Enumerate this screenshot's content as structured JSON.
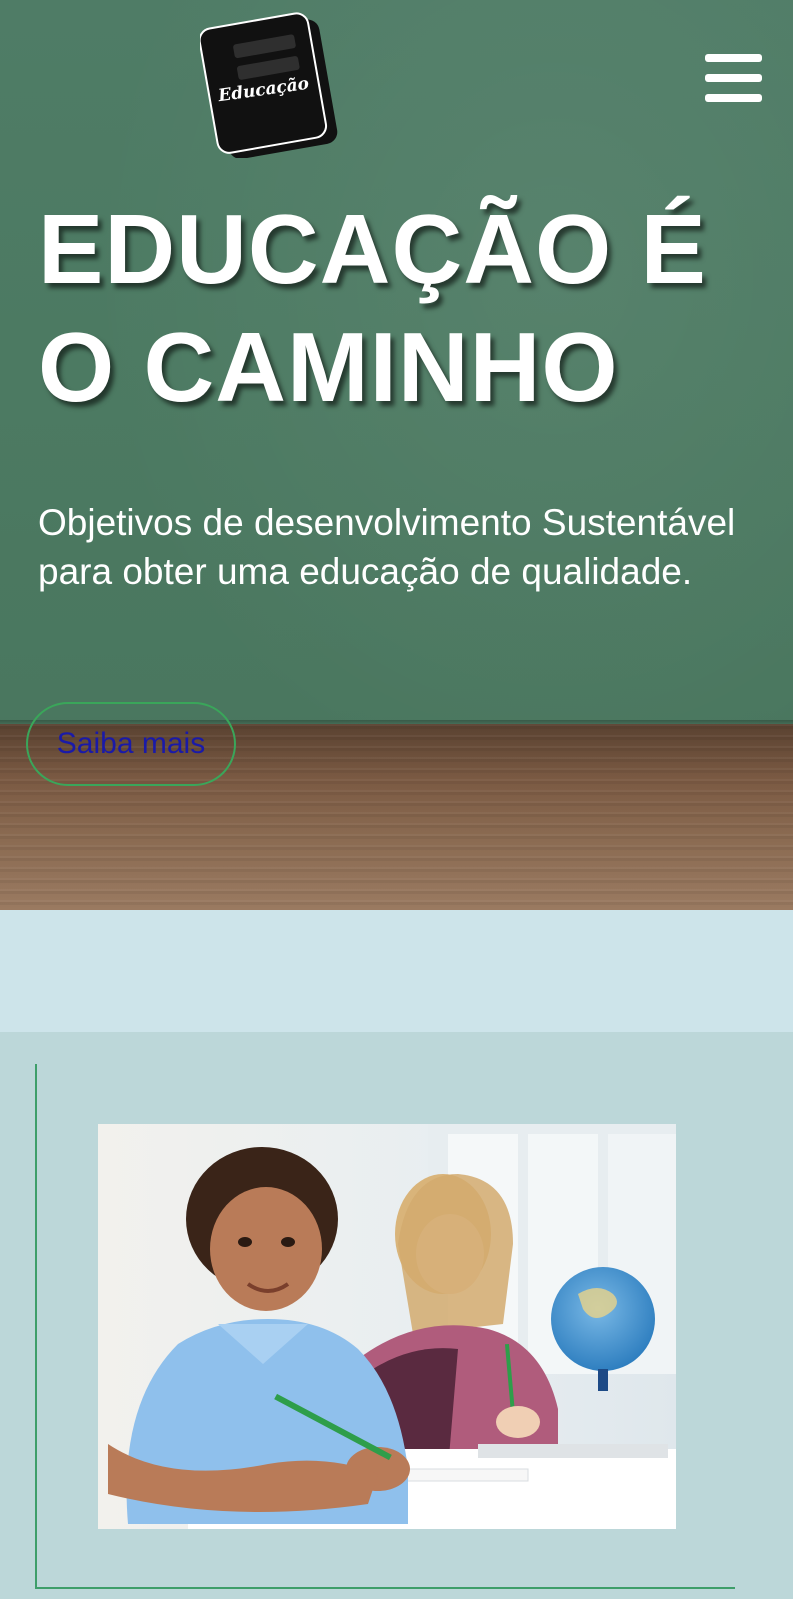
{
  "header": {
    "logo_text": "Educação",
    "logo_icon": "book-icon",
    "menu_icon": "hamburger-menu-icon"
  },
  "hero": {
    "title": "EDUCAÇÃO É O CAMINHO",
    "subtitle": "Objetivos de desenvolvimento Sustentável para obter uma educação de qualidade.",
    "cta_label": "Saiba mais"
  },
  "colors": {
    "chalkboard": "#4c7a62",
    "desk": "#7b5a43",
    "cta_border": "#3aa65a",
    "cta_text": "#1a1aa8",
    "band": "#cde4ea",
    "section_bg": "#bcd7d9",
    "frame_line": "#3e9e6a"
  }
}
